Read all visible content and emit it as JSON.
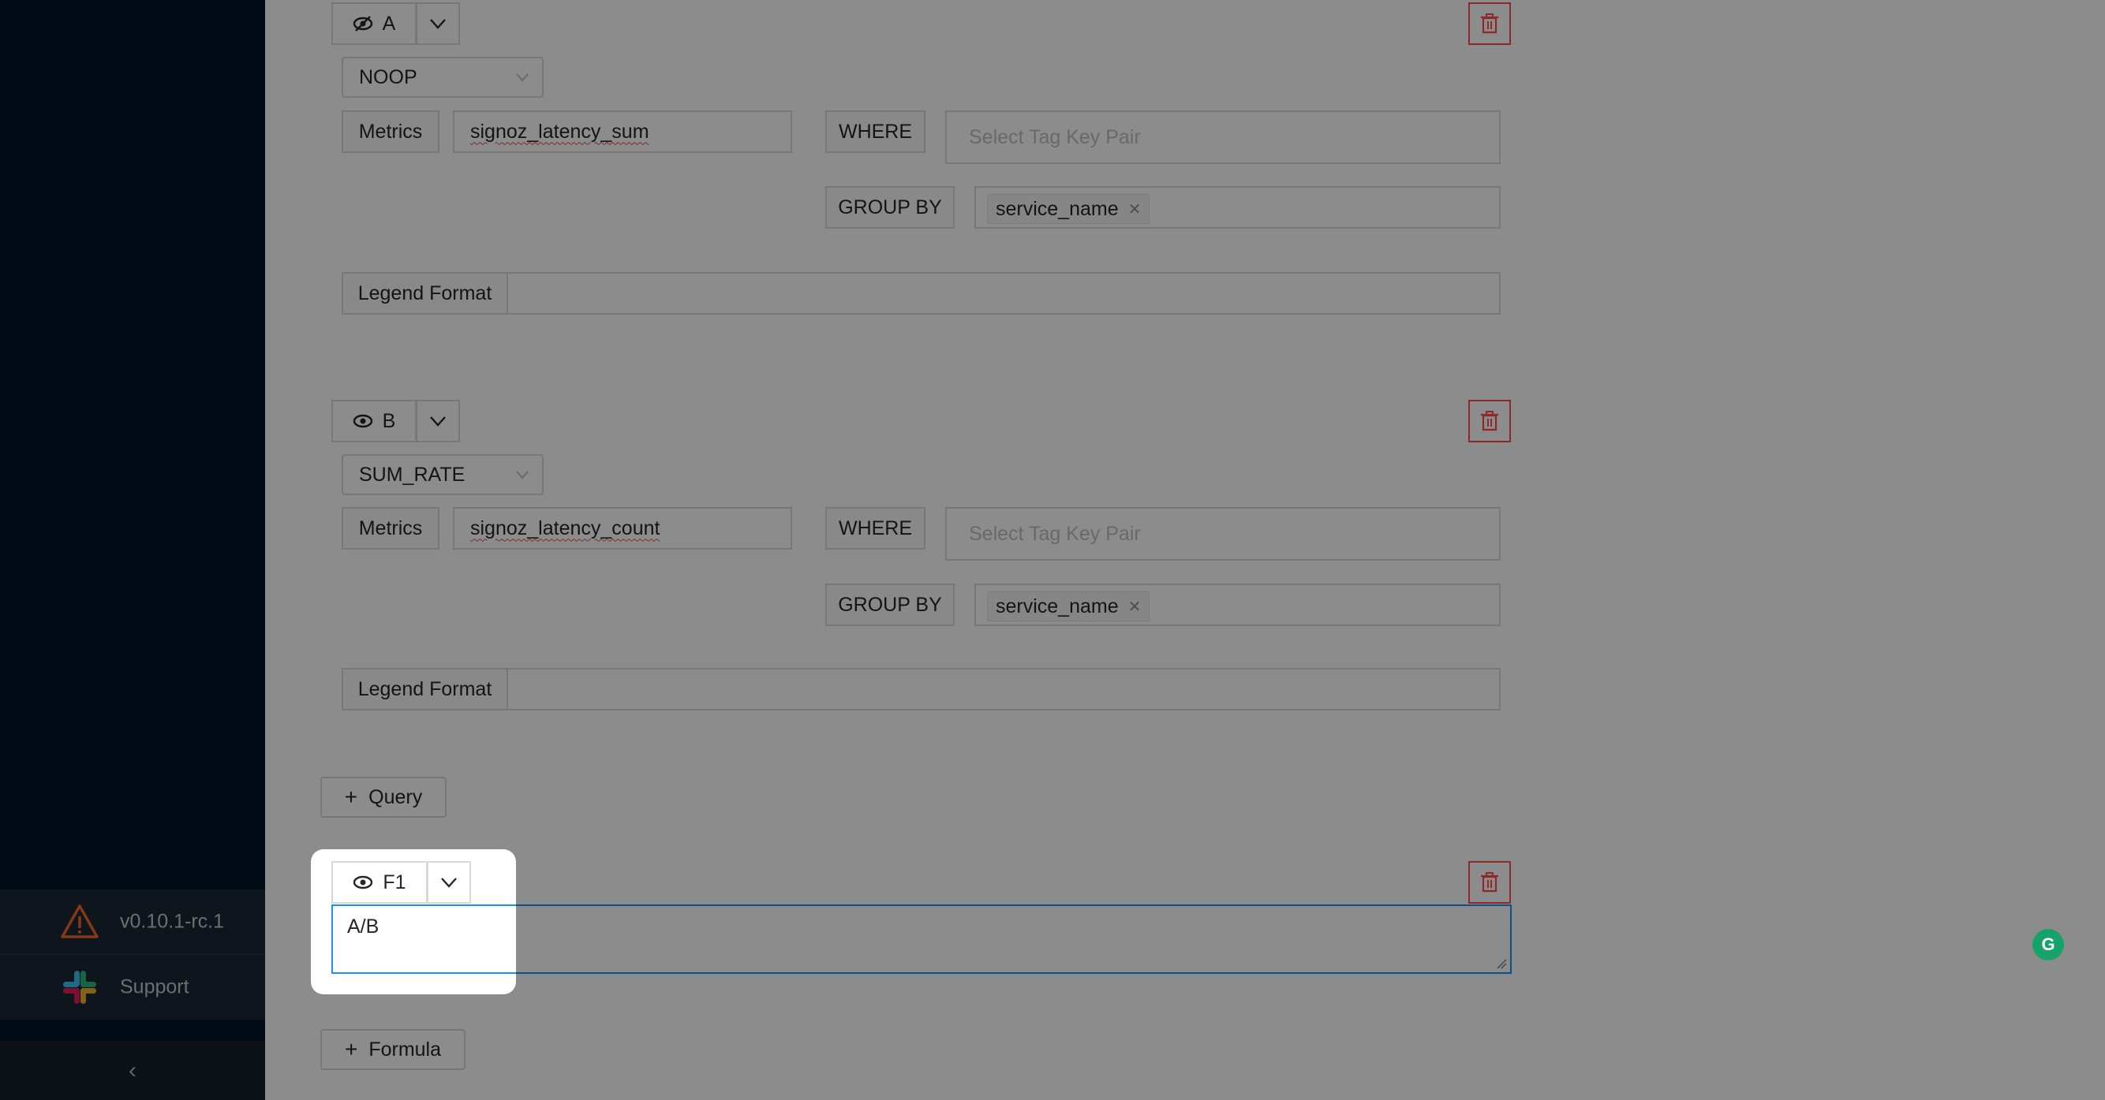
{
  "sidebar": {
    "version": "v0.10.1-rc.1",
    "support": "Support",
    "collapse_icon": "‹"
  },
  "query_a": {
    "name": "A",
    "visibility_icon": "eye-off-icon",
    "aggregation": "NOOP",
    "metrics_label": "Metrics",
    "metric_value": "signoz_latency_sum",
    "where_label": "WHERE",
    "where_placeholder": "Select Tag Key Pair",
    "group_by_label": "GROUP BY",
    "group_by_tag": "service_name",
    "legend_label": "Legend Format",
    "legend_value": ""
  },
  "query_b": {
    "name": "B",
    "visibility_icon": "eye-icon",
    "aggregation": "SUM_RATE",
    "metrics_label": "Metrics",
    "metric_value": "signoz_latency_count",
    "where_label": "WHERE",
    "where_placeholder": "Select Tag Key Pair",
    "group_by_label": "GROUP BY",
    "group_by_tag": "service_name",
    "legend_label": "Legend Format",
    "legend_value": ""
  },
  "add_query_label": "Query",
  "formula": {
    "name": "F1",
    "expression": "A/B"
  },
  "add_formula_label": "Formula",
  "colors": {
    "sidebar_bg": "#001529",
    "accent": "#1890ff",
    "danger": "#ff4d4f"
  }
}
